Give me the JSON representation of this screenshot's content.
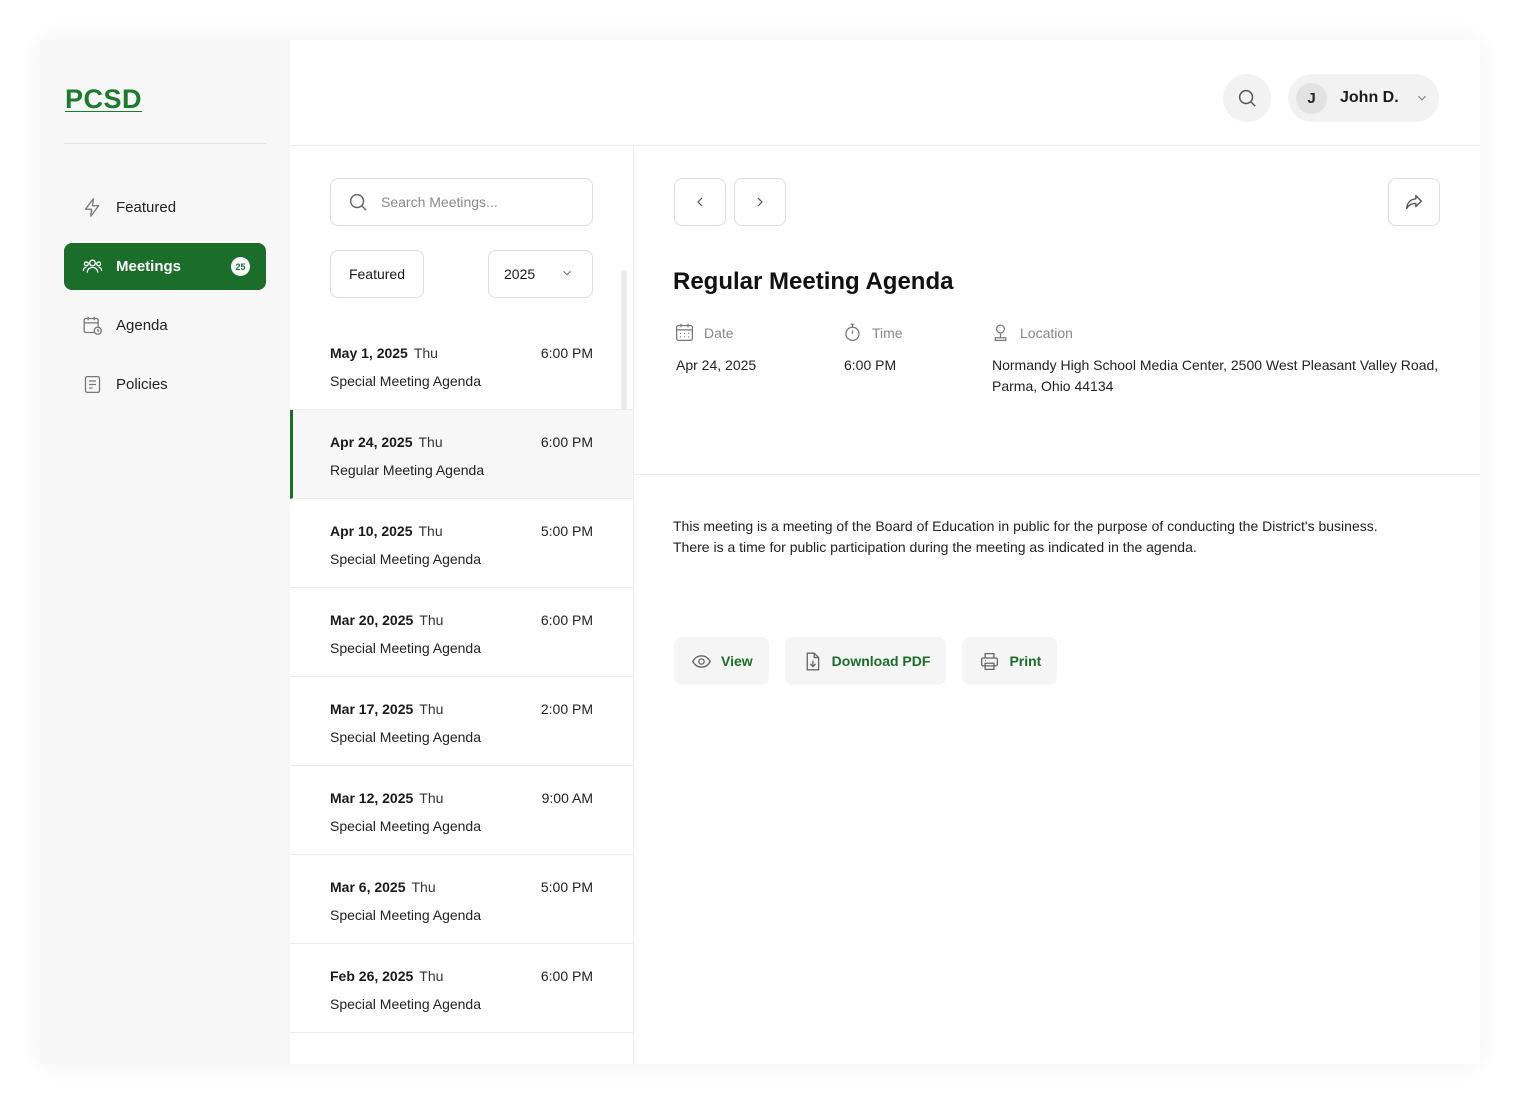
{
  "brand": {
    "logo": "PCSD",
    "accent": "#1b6e2a"
  },
  "sidebar": {
    "items": [
      {
        "label": "Featured",
        "icon": "bolt-icon"
      },
      {
        "label": "Meetings",
        "icon": "users-icon",
        "badge": "25",
        "active": true
      },
      {
        "label": "Agenda",
        "icon": "calendar-clock-icon"
      },
      {
        "label": "Policies",
        "icon": "document-icon"
      }
    ]
  },
  "header": {
    "user": {
      "initial": "J",
      "name": "John D."
    }
  },
  "list": {
    "search_placeholder": "Search Meetings...",
    "filter_label": "Featured",
    "year": "2025",
    "meetings": [
      {
        "date": "May 1, 2025",
        "day": "Thu",
        "time": "6:00 PM",
        "title": "Special Meeting Agenda"
      },
      {
        "date": "Apr 24, 2025",
        "day": "Thu",
        "time": "6:00 PM",
        "title": "Regular Meeting Agenda",
        "active": true
      },
      {
        "date": "Apr 10, 2025",
        "day": "Thu",
        "time": "5:00 PM",
        "title": "Special Meeting Agenda"
      },
      {
        "date": "Mar 20, 2025",
        "day": "Thu",
        "time": "6:00 PM",
        "title": "Special Meeting Agenda"
      },
      {
        "date": "Mar 17, 2025",
        "day": "Thu",
        "time": "2:00 PM",
        "title": "Special Meeting Agenda"
      },
      {
        "date": "Mar 12, 2025",
        "day": "Thu",
        "time": "9:00 AM",
        "title": "Special Meeting Agenda"
      },
      {
        "date": "Mar 6, 2025",
        "day": "Thu",
        "time": "5:00 PM",
        "title": "Special Meeting Agenda"
      },
      {
        "date": "Feb 26, 2025",
        "day": "Thu",
        "time": "6:00 PM",
        "title": "Special Meeting Agenda"
      }
    ]
  },
  "detail": {
    "title": "Regular Meeting Agenda",
    "date_label": "Date",
    "date_value": "Apr 24, 2025",
    "time_label": "Time",
    "time_value": "6:00 PM",
    "location_label": "Location",
    "location_value": "Normandy High School Media Center, 2500 West Pleasant Valley Road, Parma, Ohio 44134",
    "description": "This meeting is a meeting of the Board of Education in public for the purpose of conducting the District's business. There is a time for public participation during the meeting as indicated in the agenda.",
    "actions": {
      "view": "View",
      "download": "Download PDF",
      "print": "Print"
    }
  }
}
